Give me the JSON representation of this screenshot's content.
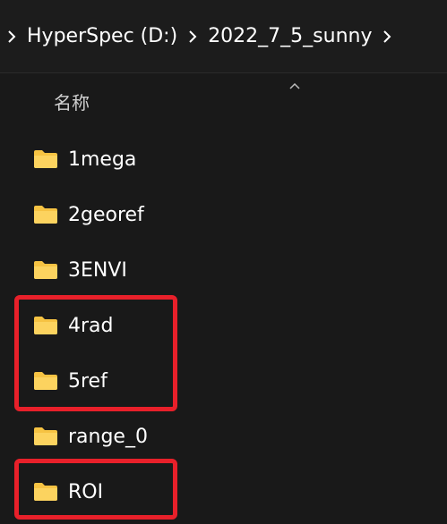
{
  "breadcrumb": {
    "items": [
      {
        "label": "HyperSpec (D:)"
      },
      {
        "label": "2022_7_5_sunny"
      }
    ]
  },
  "list": {
    "column_header": "名称",
    "sort_icon": "chevron-up-icon",
    "folder_icon": "folder-icon",
    "items": [
      {
        "name": "1mega"
      },
      {
        "name": "2georef"
      },
      {
        "name": "3ENVI"
      },
      {
        "name": "4rad"
      },
      {
        "name": "5ref"
      },
      {
        "name": "range_0"
      },
      {
        "name": "ROI"
      }
    ]
  },
  "colors": {
    "background": "#191919",
    "folder": "#f6c343",
    "highlight": "#e8202a"
  }
}
